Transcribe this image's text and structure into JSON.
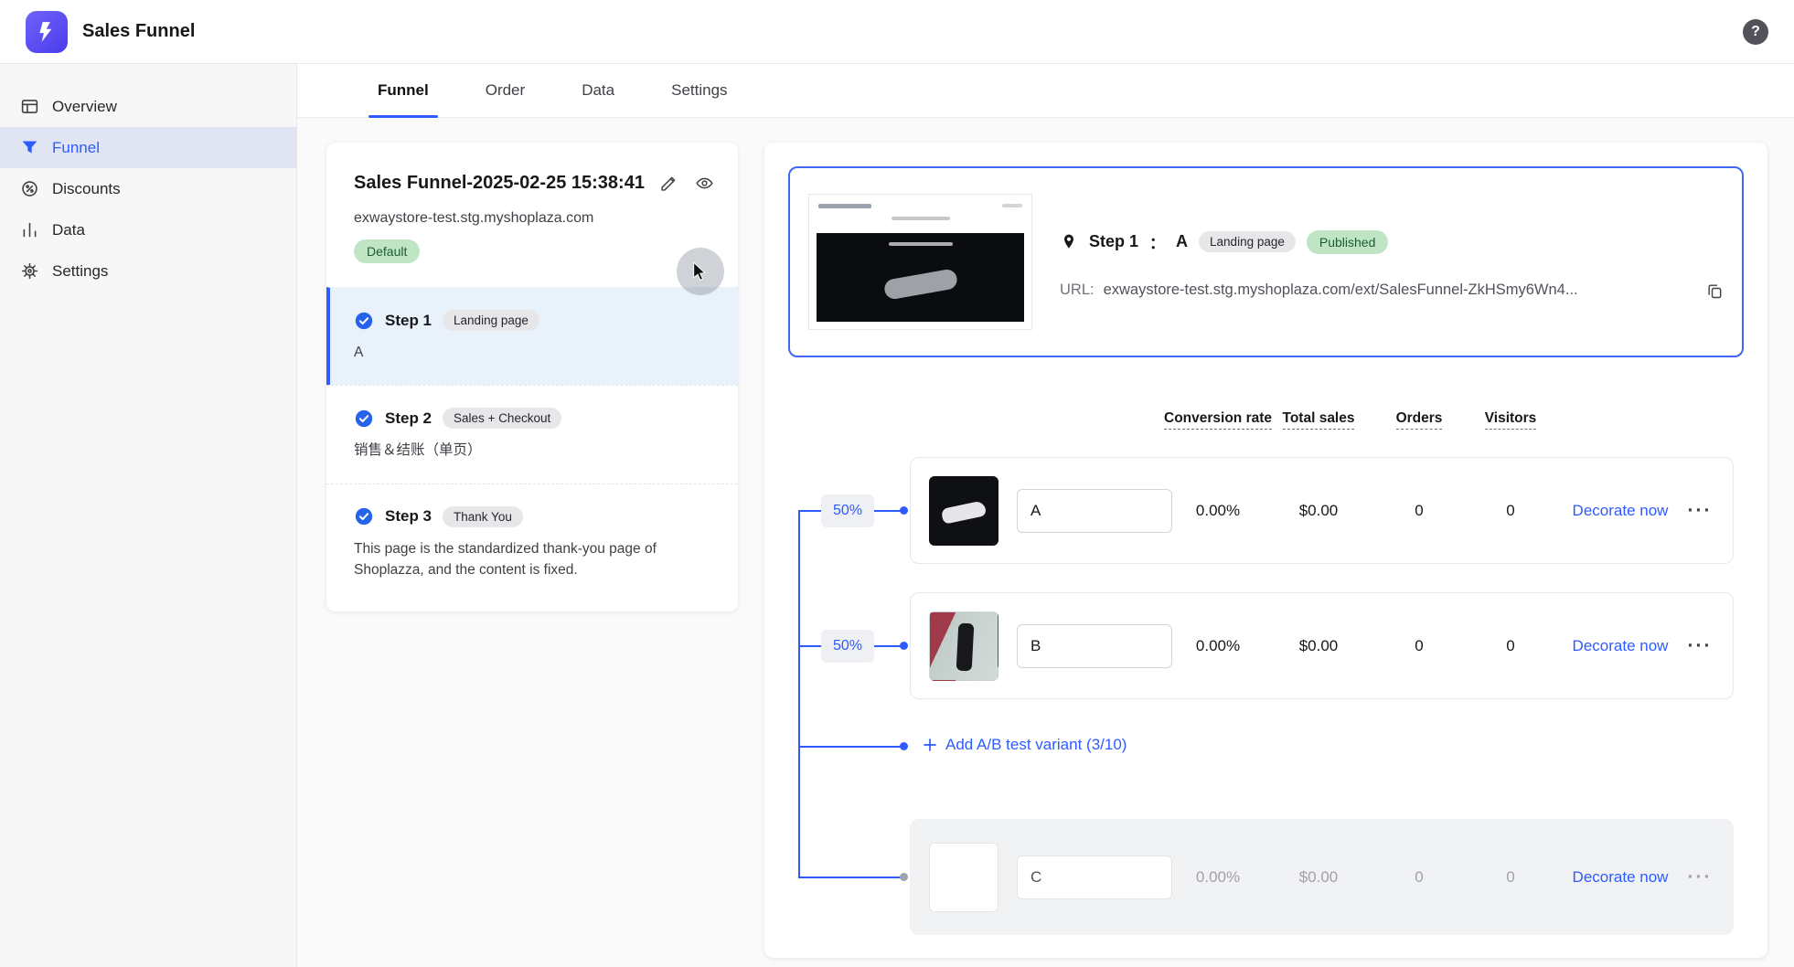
{
  "app": {
    "title": "Sales Funnel",
    "help_label": "?"
  },
  "sidebar": {
    "items": [
      {
        "label": "Overview"
      },
      {
        "label": "Funnel"
      },
      {
        "label": "Discounts"
      },
      {
        "label": "Data"
      },
      {
        "label": "Settings"
      }
    ]
  },
  "tabs": [
    {
      "label": "Funnel"
    },
    {
      "label": "Order"
    },
    {
      "label": "Data"
    },
    {
      "label": "Settings"
    }
  ],
  "funnel_card": {
    "title": "Sales Funnel-2025-02-25 15:38:41",
    "domain": "exwaystore-test.stg.myshoplaza.com",
    "default_badge": "Default",
    "steps": [
      {
        "label": "Step 1",
        "badge": "Landing page",
        "desc": "A"
      },
      {
        "label": "Step 2",
        "badge": "Sales + Checkout",
        "desc": "销售＆结账（单页）"
      },
      {
        "label": "Step 3",
        "badge": "Thank You",
        "desc": "This page is the standardized thank-you page of Shoplazza, and the content is fixed."
      }
    ]
  },
  "detail": {
    "step_label": "Step 1",
    "colon": "：",
    "step_name": "A",
    "type_badge": "Landing page",
    "status_badge": "Published",
    "url_label": "URL:",
    "url_value": "exwaystore-test.stg.myshoplaza.com/ext/SalesFunnel-ZkHSmy6Wn4...",
    "columns": [
      "Conversion rate",
      "Total sales",
      "Orders",
      "Visitors"
    ],
    "variants": [
      {
        "split": "50%",
        "name": "A",
        "conversion": "0.00%",
        "total_sales": "$0.00",
        "orders": "0",
        "visitors": "0",
        "action": "Decorate now"
      },
      {
        "split": "50%",
        "name": "B",
        "conversion": "0.00%",
        "total_sales": "$0.00",
        "orders": "0",
        "visitors": "0",
        "action": "Decorate now"
      },
      {
        "name": "C",
        "conversion": "0.00%",
        "total_sales": "$0.00",
        "orders": "0",
        "visitors": "0",
        "action": "Decorate now"
      }
    ],
    "add_variant_label": "Add A/B test variant (3/10)",
    "menu_glyph": "···"
  },
  "colors": {
    "accent_blue": "#2e5bff",
    "badge_green_bg": "#bfe5c5",
    "badge_green_text": "#1d5c33"
  }
}
